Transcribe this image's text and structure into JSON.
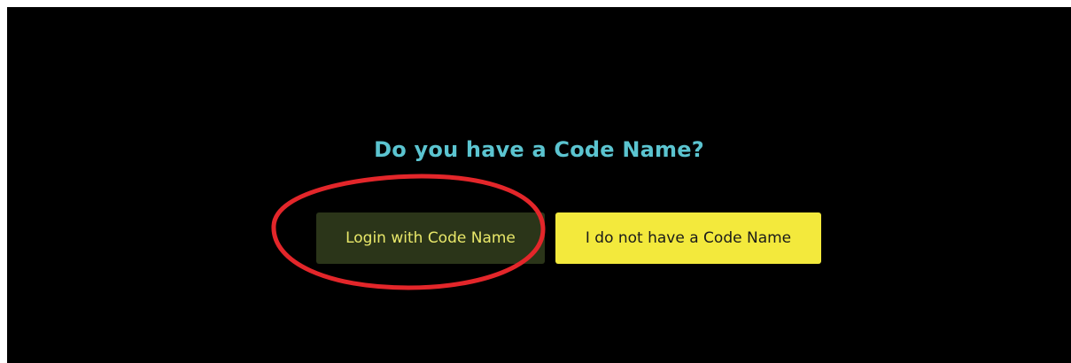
{
  "prompt": {
    "question": "Do you have a Code Name?"
  },
  "buttons": {
    "login_label": "Login with Code Name",
    "no_code_label": "I do not have a Code Name"
  },
  "colors": {
    "background": "#000000",
    "question_text": "#5bc4d0",
    "login_button_bg": "#2b3519",
    "login_button_text": "#e9e86a",
    "no_code_button_bg": "#f3e93c",
    "no_code_button_text": "#1a1a1a",
    "annotation_ring": "#e3262a"
  },
  "annotation": {
    "icon": "red-ellipse-highlight",
    "target": "login-with-code-name-button"
  }
}
